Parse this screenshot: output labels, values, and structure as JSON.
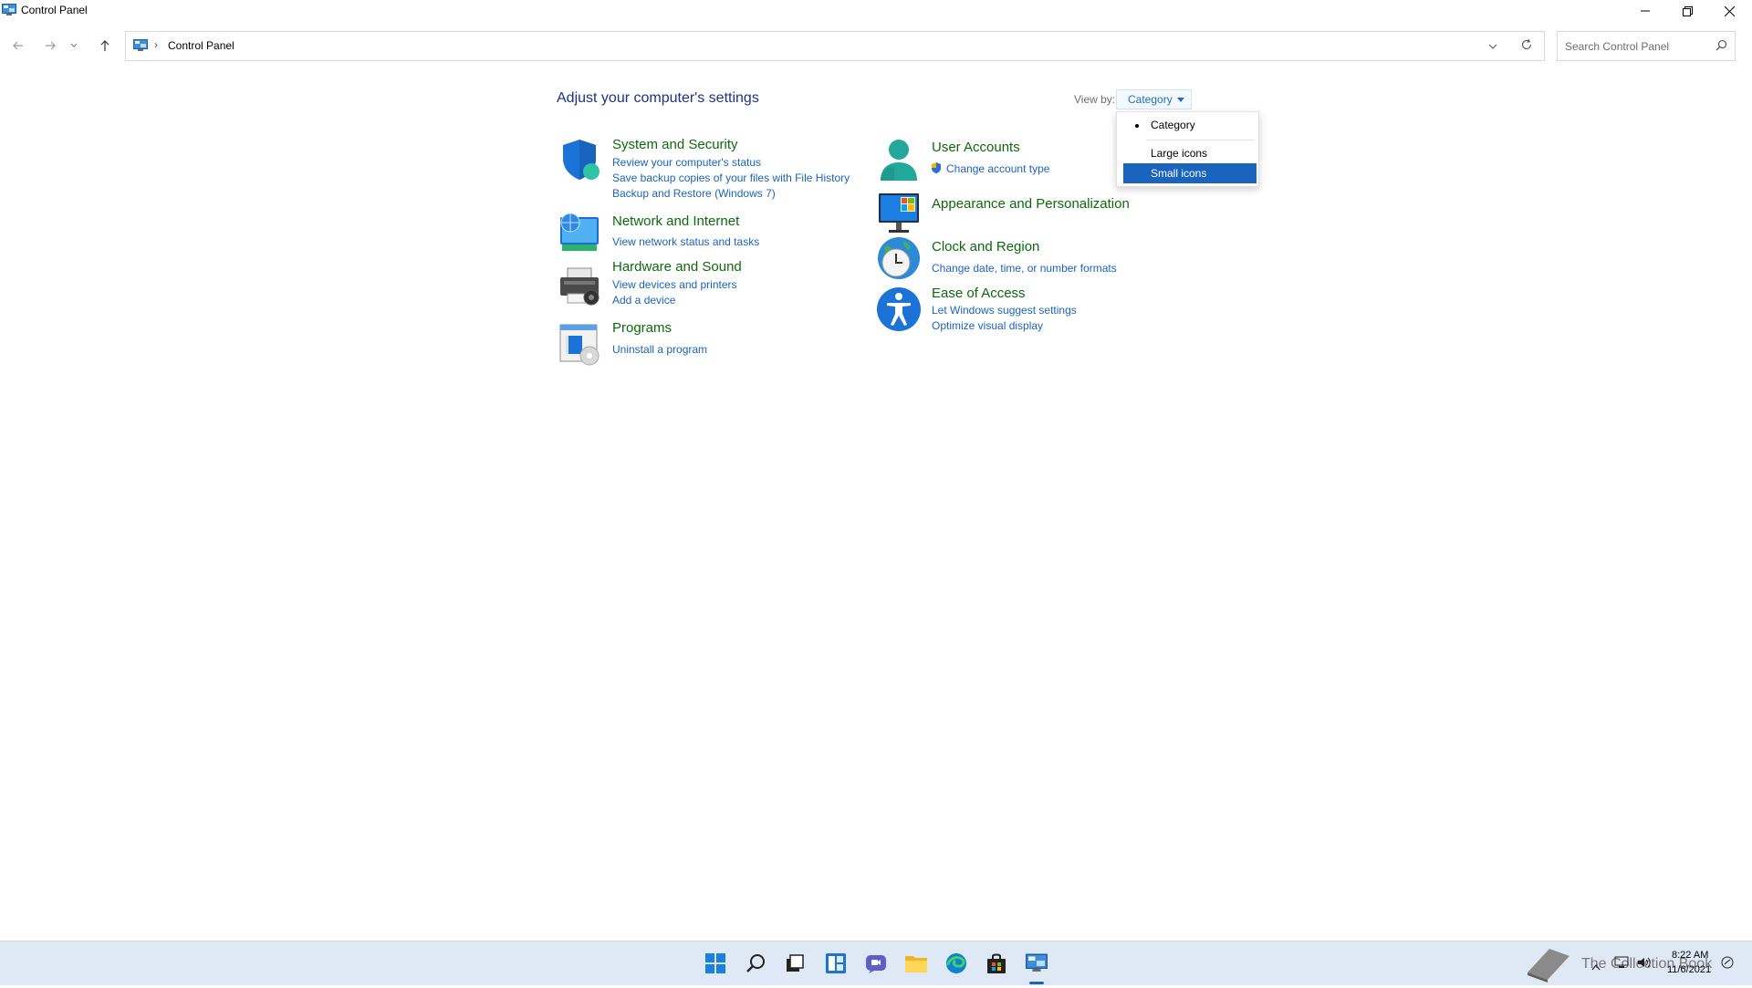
{
  "window": {
    "title": "Control Panel",
    "minimize_icon": "minimize-icon",
    "restore_icon": "restore-icon",
    "close_icon": "close-icon"
  },
  "address_bar": {
    "breadcrumb_separator": "›",
    "breadcrumb": "Control Panel",
    "search_placeholder": "Search Control Panel"
  },
  "main": {
    "heading": "Adjust your computer's settings",
    "view_by_label": "View by:",
    "view_by_value": "Category"
  },
  "view_menu": {
    "items": [
      {
        "label": "Category",
        "checked": true
      },
      {
        "label": "Large icons"
      },
      {
        "label": "Small icons",
        "highlighted": true
      }
    ]
  },
  "categories_left": [
    {
      "title": "System and Security",
      "icon": "shield-icon",
      "links": [
        "Review your computer's status",
        "Save backup copies of your files with File History",
        "Backup and Restore (Windows 7)"
      ]
    },
    {
      "title": "Network and Internet",
      "icon": "globe-network-icon",
      "links": [
        "View network status and tasks"
      ]
    },
    {
      "title": "Hardware and Sound",
      "icon": "printer-icon",
      "links": [
        "View devices and printers",
        "Add a device"
      ]
    },
    {
      "title": "Programs",
      "icon": "programs-icon",
      "links": [
        "Uninstall a program"
      ]
    }
  ],
  "categories_right": [
    {
      "title": "User Accounts",
      "icon": "user-icon",
      "links": [
        "Change account type"
      ]
    },
    {
      "title": "Appearance and Personalization",
      "icon": "monitor-icon",
      "links": []
    },
    {
      "title": "Clock and Region",
      "icon": "clock-globe-icon",
      "links": [
        "Change date, time, or number formats"
      ]
    },
    {
      "title": "Ease of Access",
      "icon": "accessibility-icon",
      "links": [
        "Let Windows suggest settings",
        "Optimize visual display"
      ]
    }
  ],
  "taskbar": {
    "apps": [
      "start-icon",
      "search-icon",
      "task-view-icon",
      "widgets-icon",
      "chat-icon",
      "file-explorer-icon",
      "edge-icon",
      "store-icon",
      "control-panel-icon"
    ],
    "time": "8:22 AM",
    "date": "11/6/2021",
    "watermark": "The Collection Book"
  },
  "colors": {
    "title_text": "#1e3287",
    "category_title": "#0b6a0b",
    "link": "#1a64bd",
    "menu_highlight": "#1a64bd",
    "taskbar_bg": "#dfe9f6"
  }
}
